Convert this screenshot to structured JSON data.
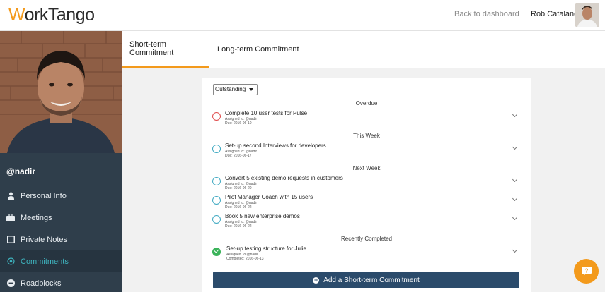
{
  "header": {
    "logo_prefix": "W",
    "logo_rest": "orkTango",
    "back_link": "Back to dashboard",
    "user_name": "Rob Catalano"
  },
  "sidebar": {
    "handle": "@nadir",
    "items": [
      {
        "label": "Personal Info",
        "icon": "person-icon"
      },
      {
        "label": "Meetings",
        "icon": "briefcase-icon"
      },
      {
        "label": "Private Notes",
        "icon": "note-icon"
      },
      {
        "label": "Commitments",
        "icon": "target-icon",
        "active": true
      },
      {
        "label": "Roadblocks",
        "icon": "minus-circle-icon"
      }
    ]
  },
  "tabs": [
    {
      "label": "Short-term Commitment",
      "active": true
    },
    {
      "label": "Long-term Commitment",
      "active": false
    }
  ],
  "filter": {
    "selected": "Outstanding"
  },
  "sections": [
    {
      "title": "Overdue",
      "items": [
        {
          "title": "Complete 10 user tests for Pulse",
          "assigned": "Assigned to:  @nadir",
          "date": "Due: 2016-06-10",
          "status": "overdue"
        }
      ]
    },
    {
      "title": "This Week",
      "items": [
        {
          "title": "Set-up second Interviews for developers",
          "assigned": "Assigned to:  @nadir",
          "date": "Due: 2016-06-17",
          "status": "open"
        }
      ]
    },
    {
      "title": "Next Week",
      "items": [
        {
          "title": "Convert 5 existing demo requests in customers",
          "assigned": "Assigned to:  @nadir",
          "date": "Due: 2016-06-20",
          "status": "open"
        },
        {
          "title": "Pilot Manager Coach with 15 users",
          "assigned": "Assigned to:  @nadir",
          "date": "Due: 2016-06-22",
          "status": "open"
        },
        {
          "title": "Book 5 new enterprise demos",
          "assigned": "Assigned to:  @nadir",
          "date": "Due: 2016-06-22",
          "status": "open"
        }
      ]
    },
    {
      "title": "Recently Completed",
      "items": [
        {
          "title": "Set-up testing structure for Julie",
          "assigned": "Assigned To:@nadir",
          "date": "Completed:  2016-06-13",
          "status": "done"
        }
      ]
    }
  ],
  "add_button": {
    "label": "Add a Short-term Commitment"
  },
  "colors": {
    "accent": "#f39a1c",
    "sidebar": "#2f3e4b",
    "active_nav": "#3fb6c1",
    "button": "#2b4b6b",
    "overdue": "#e04a4a",
    "done": "#3bb35a"
  }
}
